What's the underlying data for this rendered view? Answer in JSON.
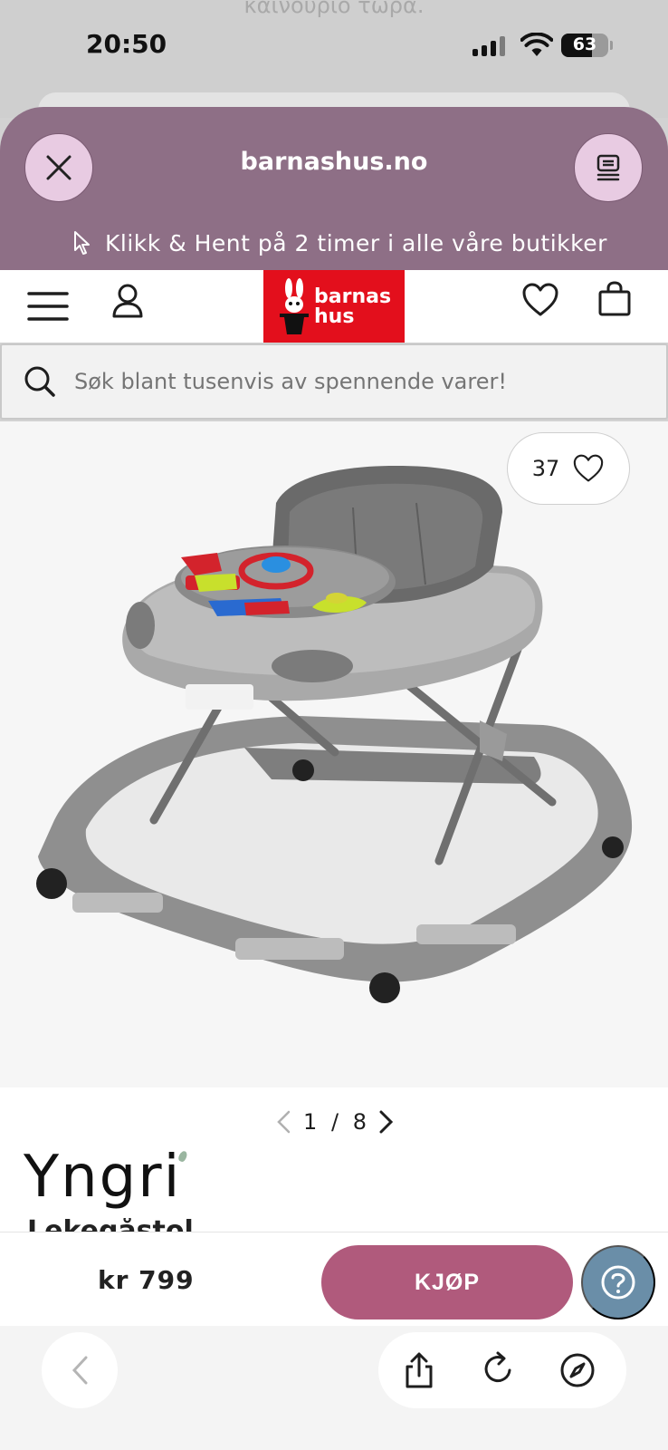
{
  "background": {
    "ghost_text": "καινούριο τώρα."
  },
  "status_bar": {
    "time": "20:50",
    "battery": "63"
  },
  "browser": {
    "domain": "barnashus.no",
    "close_icon": "close-icon",
    "reader_icon": "reader-mode-icon"
  },
  "promo": {
    "text": "Klikk & Hent på 2 timer i alle våre butikker"
  },
  "logo": {
    "line1": "barnas",
    "line2": "hus"
  },
  "search": {
    "placeholder": "Søk blant tusenvis av spennende varer!"
  },
  "product": {
    "likes": "37",
    "pager_current": "1",
    "pager_sep": "/",
    "pager_total": "8",
    "brand": "Yngri",
    "name_partial": "Lekegåstol"
  },
  "buy": {
    "price": "kr 799",
    "button": "KJØP"
  },
  "colors": {
    "header": "#8e6f86",
    "logo_red": "#e30f1c",
    "buy_button": "#b05a7c",
    "help_button": "#6a8ea8"
  }
}
